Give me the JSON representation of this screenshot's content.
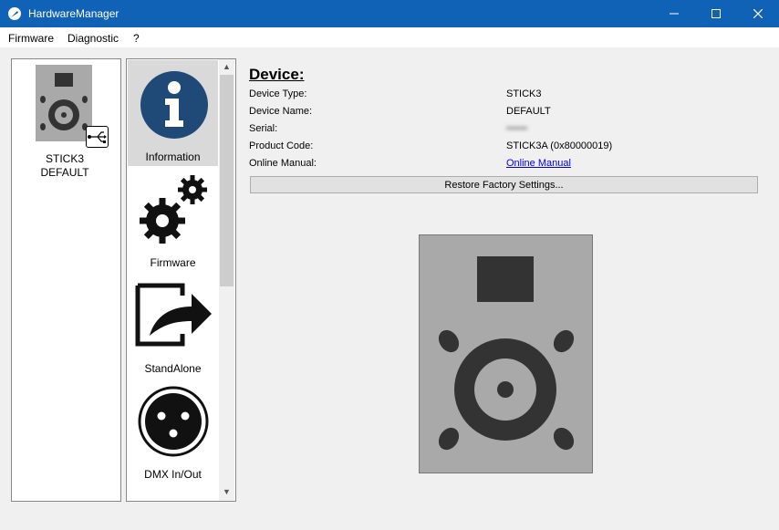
{
  "window": {
    "title": "HardwareManager"
  },
  "menu": {
    "items": [
      "Firmware",
      "Diagnostic",
      "?"
    ]
  },
  "device_list": {
    "items": [
      {
        "model": "STICK3",
        "name": "DEFAULT"
      }
    ]
  },
  "nav": {
    "items": [
      {
        "label": "Information",
        "icon": "info-icon",
        "selected": true
      },
      {
        "label": "Firmware",
        "icon": "gears-icon"
      },
      {
        "label": "StandAlone",
        "icon": "export-arrow-icon"
      },
      {
        "label": "DMX In/Out",
        "icon": "xlr-connector-icon"
      }
    ]
  },
  "details": {
    "heading": "Device:",
    "rows": [
      {
        "label": "Device Type:",
        "value": "STICK3"
      },
      {
        "label": "Device Name:",
        "value": "DEFAULT"
      },
      {
        "label": "Serial:",
        "value": "••••••"
      },
      {
        "label": "Product Code:",
        "value": "STICK3A (0x80000019)"
      },
      {
        "label": "Online Manual:",
        "value": "Online Manual"
      }
    ],
    "restore_label": "Restore Factory Settings..."
  },
  "colors": {
    "titlebar": "#0f62b6",
    "device_body": "#a9a9a9",
    "device_dark": "#333333",
    "info_icon": "#1f4a78",
    "link": "#0000ee"
  }
}
